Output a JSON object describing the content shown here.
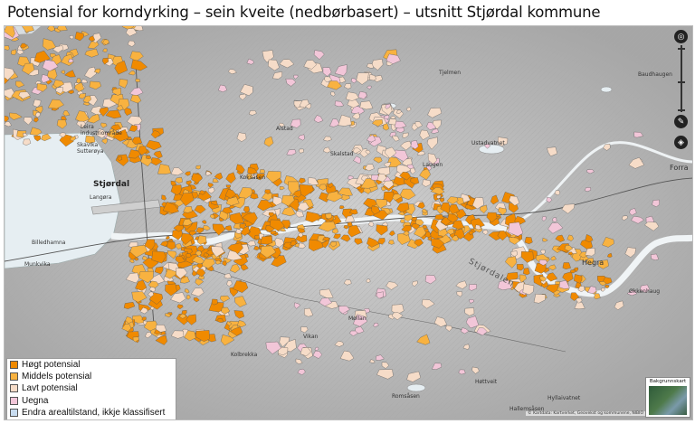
{
  "title": "Potensial for korndyrking – sein kveite (nedbørbasert) – utsnitt Stjørdal kommune",
  "legend": {
    "items": [
      {
        "label": "Høgt potensial",
        "color": "#f08a00"
      },
      {
        "label": "Middels potensial",
        "color": "#f8b240"
      },
      {
        "label": "Lavt potensial",
        "color": "#f6dcc8"
      },
      {
        "label": "Uegna",
        "color": "#f2c6d8"
      },
      {
        "label": "Endra arealtilstand, ikkje klassifisert",
        "color": "#c8dcf0"
      }
    ]
  },
  "places": {
    "stjordal": "Stjørdal",
    "langora": "Langøra",
    "hegra": "Hegra",
    "forra": "Forra",
    "stjordalen": "Stjørdalen",
    "koksaas": "Koksåsen",
    "ustadvatnet": "Ustadvatnet",
    "romsaas": "Romsåsen",
    "hallemsaas": "Hallemsåsen",
    "hottveit": "Høttveit",
    "leira": "Leira industriområde",
    "skavika": "Skavika Sutterøya",
    "bilsdhamn": "Billedhamna",
    "munkvika": "Munkvika",
    "hyllaivatnet": "Hyllaivatnet",
    "skalstad": "Skalstad",
    "laugen": "Laugen",
    "alstad": "Alstad",
    "kolbrekka": "Kolbrekka",
    "tjelmen": "Tjelmen",
    "mollan": "Møllan",
    "vikan": "Vikan",
    "okkenhaug": "Økkenhaug",
    "baudhaugen": "Baudhaugen"
  },
  "controls": {
    "locate_icon": "target-icon",
    "measure_icon": "pencil-icon",
    "layers_icon": "layers-icon",
    "zoom_in": "+",
    "zoom_out": "−"
  },
  "attribution": "© Kartdata: Kartverket, Geovekst og kommunene, NIBIO",
  "basemap_label": "Bakgrunnskart"
}
